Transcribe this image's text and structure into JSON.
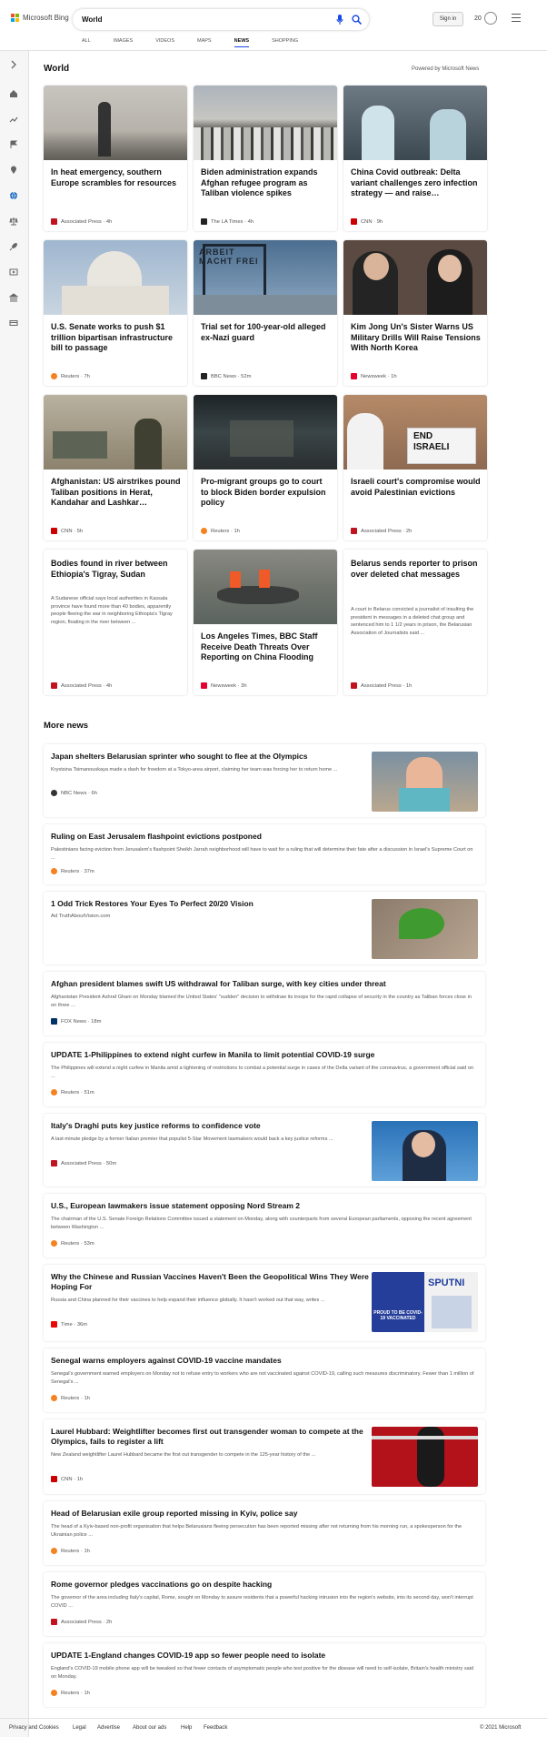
{
  "header": {
    "brand": "Microsoft Bing",
    "search_value": "World",
    "signin": "Sign in",
    "rewards": "20"
  },
  "tabs": [
    "ALL",
    "IMAGES",
    "VIDEOS",
    "MAPS",
    "NEWS",
    "SHOPPING"
  ],
  "section": {
    "title": "World",
    "powered": "Powered by Microsoft News"
  },
  "cards": [
    {
      "title": "In heat emergency, southern Europe scrambles for resources",
      "source": "Associated Press · 4h",
      "logo": "#c1121f"
    },
    {
      "title": "Biden administration expands Afghan refugee program as Taliban violence spikes",
      "source": "The LA Times · 4h",
      "logo": "#222222"
    },
    {
      "title": "China Covid outbreak: Delta variant challenges zero infection strategy — and raise…",
      "source": "CNN · 9h",
      "logo": "#cc0000"
    },
    {
      "title": "U.S. Senate works to push $1 trillion bipartisan infrastructure bill to passage",
      "source": "Reuters · 7h",
      "logo": "#f58220"
    },
    {
      "title": "Trial set for 100-year-old alleged ex-Nazi guard",
      "source": "BBC News · 52m",
      "logo": "#222222"
    },
    {
      "title": "Kim Jong Un's Sister Warns US Military Drills Will Raise Tensions With North Korea",
      "source": "Newsweek · 1h",
      "logo": "#e4032e"
    },
    {
      "title": "Afghanistan: US airstrikes pound Taliban positions in Herat, Kandahar and Lashkar…",
      "source": "CNN · 5h",
      "logo": "#cc0000"
    },
    {
      "title": "Pro-migrant groups go to court to block Biden border expulsion policy",
      "source": "Reuters · 1h",
      "logo": "#f58220"
    },
    {
      "title": "Israeli court's compromise would avoid Palestinian evictions",
      "source": "Associated Press · 2h",
      "logo": "#c1121f"
    },
    {
      "title": "Bodies found in river between Ethiopia's Tigray, Sudan",
      "desc": "A Sudanese official says local authorities in Kassala province have found more than 40 bodies, apparently people fleeing the war in neighboring Ethiopia's Tigray region, floating in the river between ...",
      "source": "Associated Press · 4h",
      "logo": "#c1121f"
    },
    {
      "title": "Los Angeles Times, BBC Staff Receive Death Threats Over Reporting on China Flooding",
      "source": "Newsweek · 3h",
      "logo": "#e4032e"
    },
    {
      "title": "Belarus sends reporter to prison over deleted chat messages",
      "desc": "A court in Belarus convicted a journalist of insulting the president in messages in a deleted chat group and sentenced him to 1 1/2 years in prison, the Belarusian Association of Journalists said ...",
      "source": "Associated Press · 1h",
      "logo": "#c1121f"
    }
  ],
  "more_title": "More news",
  "more": [
    {
      "title": "Japan shelters Belarusian sprinter who sought to flee at the Olympics",
      "desc": "Krystsina Tsimanouskaya made a dash for freedom at a Tokyo-area airport, claiming her team was forcing her to return home ...",
      "source": "NBC News · 6h",
      "logo": "#333333"
    },
    {
      "title": "Ruling on East Jerusalem flashpoint evictions postponed",
      "desc": "Palestinians facing eviction from Jerusalem's flashpoint Sheikh Jarrah neighborhood will have to wait for a ruling that will determine their fate after a discussion in Israel's Supreme Court on ...",
      "source": "Reuters · 37m",
      "logo": "#f58220"
    },
    {
      "title": "1 Odd Trick Restores Your Eyes To Perfect 20/20 Vision",
      "desc": "",
      "source": "Ad   TruthAboutVision.com",
      "logo": ""
    },
    {
      "title": "Afghan president blames swift US withdrawal for Taliban surge, with key cities under threat",
      "desc": "Afghanistan President Ashraf Ghani on Monday blamed the United States' \"sudden\" decision to withdraw its troops for the rapid collapse of security in the country as Taliban forces close in on three ...",
      "source": "FOX News · 18m",
      "logo": "#003366"
    },
    {
      "title": "UPDATE 1-Philippines to extend night curfew in Manila to limit potential COVID-19 surge",
      "desc": "The Philippines will extend a night curfew in Manila amid a tightening of restrictions to combat a potential surge in cases of the Delta variant of the coronavirus, a government official said on ...",
      "source": "Reuters · 51m",
      "logo": "#f58220"
    },
    {
      "title": "Italy's Draghi puts key justice reforms to confidence vote",
      "desc": "A last-minute pledge by a former Italian premier that populist 5-Star Movement lawmakers would back a key justice reforms ...",
      "source": "Associated Press · 50m",
      "logo": "#c1121f"
    },
    {
      "title": "U.S., European lawmakers issue statement opposing Nord Stream 2",
      "desc": "The chairman of the U.S. Senate Foreign Relations Committee issued a statement on Monday, along with counterparts from several European parliaments, opposing the recent agreement between Washington ...",
      "source": "Reuters · 53m",
      "logo": "#f58220"
    },
    {
      "title": "Why the Chinese and Russian Vaccines Haven't Been the Geopolitical Wins They Were Hoping For",
      "desc": "Russia and China planned for their vaccines to help expand their influence globally. It hasn't worked out that way, writes ...",
      "source": "Time · 36m",
      "logo": "#e90606"
    },
    {
      "title": "Senegal warns employers against COVID-19 vaccine mandates",
      "desc": "Senegal's government warned employers on Monday not to refuse entry to workers who are not vaccinated against COVID-19, calling such measures discriminatory. Fewer than 1 million of Senegal's ...",
      "source": "Reuters · 1h",
      "logo": "#f58220"
    },
    {
      "title": "Laurel Hubbard: Weightlifter becomes first out transgender woman to compete at the Olympics, fails to register a lift",
      "desc": "New Zealand weightlifter Laurel Hubbard became the first out transgender to compete in the 125-year history of the ...",
      "source": "CNN · 1h",
      "logo": "#cc0000"
    },
    {
      "title": "Head of Belarusian exile group reported missing in Kyiv, police say",
      "desc": "The head of a Kyiv-based non-profit organisation that helps Belarusians fleeing persecution has been reported missing after not returning from his morning run, a spokesperson for the Ukrainian police ...",
      "source": "Reuters · 1h",
      "logo": "#f58220"
    },
    {
      "title": "Rome governor pledges vaccinations go on despite hacking",
      "desc": "The governor of the area including Italy's capital, Rome, sought on Monday to assure residents that a powerful hacking intrusion into the region's website, into its second day, won't interrupt COVID ...",
      "source": "Associated Press · 2h",
      "logo": "#c1121f"
    },
    {
      "title": "UPDATE 1-England changes COVID-19 app so fewer people need to isolate",
      "desc": "England's COVID-19 mobile phone app will be tweaked so that fewer contacts of asymptomatic people who test positive for the disease will need to self-isolate, Britain's health ministry said on Monday.",
      "source": "Reuters · 1h",
      "logo": "#f58220"
    }
  ],
  "img_text": {
    "sign1": "ARBEIT MACHT FREI",
    "sign2": "END ISRAELI",
    "sign3": "PROUD TO BE COVID-19 VACCINATED",
    "sign4": "SPUTNI"
  },
  "footer": {
    "privacy": "Privacy and Cookies",
    "legal": "Legal",
    "advertise": "Advertise",
    "about": "About our ads",
    "help": "Help",
    "feedback": "Feedback",
    "copyright": "© 2021 Microsoft"
  }
}
